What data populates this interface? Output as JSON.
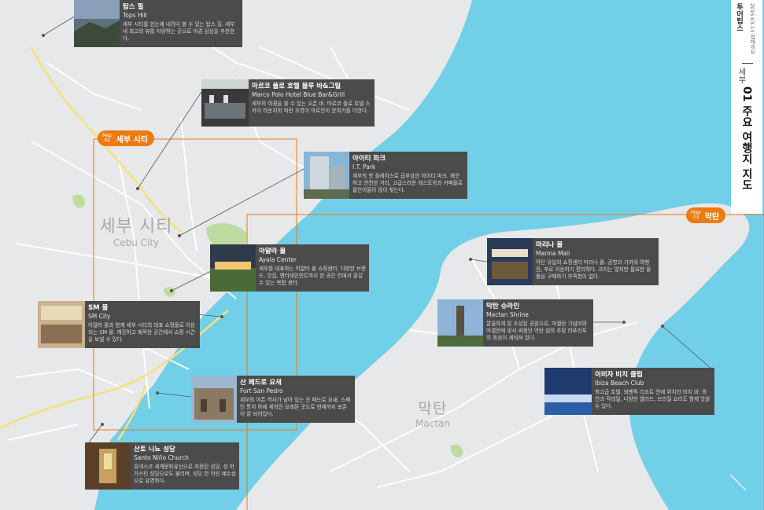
{
  "header": {
    "brand": "투어팁스",
    "update": "2015.03.13 업데이트",
    "area": "세부",
    "title": "01 주요 여행지 지도"
  },
  "regions": [
    {
      "map_no": "02",
      "name": "세부 시티"
    },
    {
      "map_no": "03",
      "name": "막탄"
    }
  ],
  "cities": [
    {
      "ko": "세부 시티",
      "en": "Cebu City"
    },
    {
      "ko": "막탄",
      "en": "Mactan"
    }
  ],
  "places": [
    {
      "ko": "탑스 힐",
      "en": "Tops Hill",
      "desc": "세부 시티를 한눈에 내려다 볼 수 있는 탑스 힐. 세부 내 최고의 뷰를 자랑하는 곳으로 야경 감상을 추천한다."
    },
    {
      "ko": "마르코 폴로 호텔 블루 바&그릴",
      "en": "Marco Polo Hotel Blue Bar&Grill",
      "desc": "세부의 야경을 볼 수 있는 오픈 바. 마르코 폴로 호텔 스카이 라운지의 파란 조명이 아로안이 분위기를 더한다."
    },
    {
      "ko": "아이티 파크",
      "en": "I.T. Park",
      "desc": "세부의 핫 플레이스로 급부상한 아이티 파크. 깨끗하고 안전한 거리, 고급스러운 레스토랑과 카페들로 젊은이들이 많이 찾는다."
    },
    {
      "ko": "아얄라 몰",
      "en": "Ayala Center",
      "desc": "세부를 대표하는 아얄라 몰 쇼핑센터. 다양한 브랜드, 맛집, 엔터테인먼트까지 한 공간 안에서 즐길 수 있는 복합 센터."
    },
    {
      "ko": "SM 몰",
      "en": "SM City",
      "desc": "아얄라 몰과 함께 세부 시티의 대표 쇼핑몰로 이용되는 SM 몰. 깨끗하고 쾌적한 공간에서 쇼핑 시간을 보낼 수 있다."
    },
    {
      "ko": "산 페드로 요새",
      "en": "Fort San Pedro",
      "desc": "세부의 아픈 역사가 남아 있는 산 페드로 요새. 스페인 통치 하에 세워진 요래된 곳으로 현재까지 보존이 잘 되어있다."
    },
    {
      "ko": "산토 니뇨 성당",
      "en": "Santo Niño Church",
      "desc": "유네스코 세계문화유산으로 지정된 성당. 성 어거스틴 성당으로도 불리며, 성당 안 어린 예수상으로 유명하다."
    },
    {
      "ko": "마리나 몰",
      "en": "Marina Mall",
      "desc": "막탄 유일의 쇼핑센터 마리나 몰. 공항과 가까워 여행 전, 후로 이용하기 편리하다. 크지는 않지만 필요한 물품을 구매하기 부족함이 없다."
    },
    {
      "ko": "막탄 슈라인",
      "en": "Mactan Shrine",
      "desc": "깔끔하게 잘 조성된 공원으로, 마젤란 기념비와 마젤란에 맞서 싸웠던 막탄 섬의 추장 라푸라푸의 동상이 세워져 있다."
    },
    {
      "ko": "이비자 비치 클럽",
      "en": "Ibiza Beach Club",
      "desc": "최고급 호텔, 뫼벤픽 리조트 안에 위치한 비치 바. 와인과 칵테일, 다양한 샐러드, 브라질 요리도 함께 맛볼 수 있다."
    }
  ],
  "colors": {
    "water": "#72cfe8",
    "land": "#e6e8ea",
    "road_major": "#f5e27a",
    "park": "#bfdca0",
    "card": "#4b4b4b",
    "accent": "#ee7a10"
  }
}
